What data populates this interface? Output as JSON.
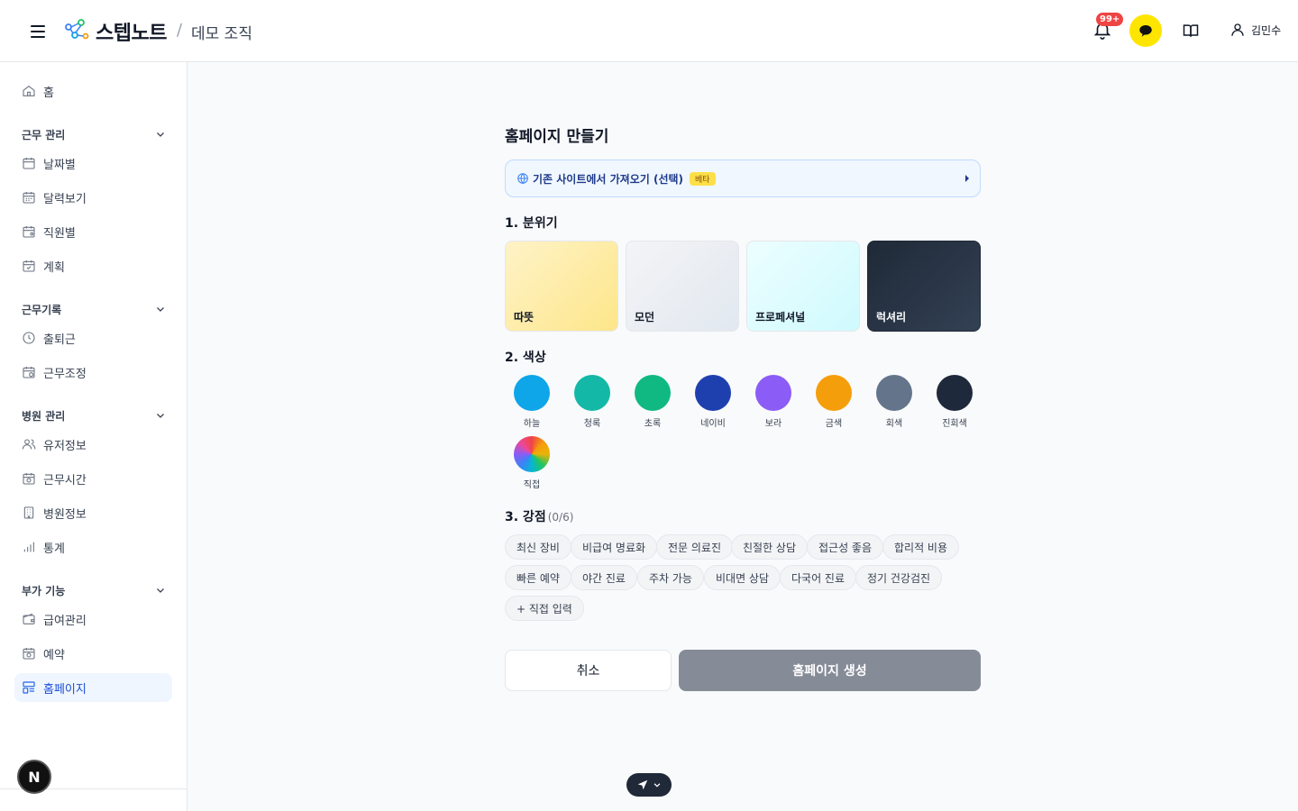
{
  "header": {
    "brand": "스텝노트",
    "separator": "/",
    "org": "데모 조직",
    "notif_badge": "99+",
    "user_name": "김민수"
  },
  "sidebar": {
    "home": "홈",
    "sections": [
      {
        "label": "근무 관리",
        "items": [
          "날짜별",
          "달력보기",
          "직원별",
          "계획"
        ]
      },
      {
        "label": "근무기록",
        "items": [
          "출퇴근",
          "근무조정"
        ]
      },
      {
        "label": "병원 관리",
        "items": [
          "유저정보",
          "근무시간",
          "병원정보",
          "통계"
        ]
      },
      {
        "label": "부가 기능",
        "items": [
          "급여관리",
          "예약",
          "홈페이지"
        ]
      }
    ],
    "bottom_badge": "N"
  },
  "main": {
    "title": "홈페이지 만들기",
    "import_label": "기존 사이트에서 가져오기 (선택)",
    "beta_label": "베타",
    "step1": "1. 분위기",
    "moods": [
      {
        "label": "따뜻",
        "color": "#fde68a"
      },
      {
        "label": "모던",
        "color": "#e5e7eb"
      },
      {
        "label": "프로페셔널",
        "color": "#cffafe"
      },
      {
        "label": "럭셔리",
        "color": "#1f2937"
      }
    ],
    "step2": "2. 색상",
    "colors": [
      {
        "label": "하늘",
        "color": "#0ea5e9"
      },
      {
        "label": "청록",
        "color": "#14b8a6"
      },
      {
        "label": "초록",
        "color": "#10b981"
      },
      {
        "label": "네이비",
        "color": "#1e40af"
      },
      {
        "label": "보라",
        "color": "#8b5cf6"
      },
      {
        "label": "금색",
        "color": "#f59e0b"
      },
      {
        "label": "회색",
        "color": "#64748b"
      },
      {
        "label": "진회색",
        "color": "#1e293b"
      },
      {
        "label": "직접",
        "color": "rainbow"
      }
    ],
    "step3": "3. 강점",
    "step3_count": "(0/6)",
    "strengths": [
      "최신 장비",
      "비급여 명료화",
      "전문 의료진",
      "친절한 상담",
      "접근성 좋음",
      "합리적 비용",
      "빠른 예약",
      "야간 진료",
      "주차 가능",
      "비대면 상담",
      "다국어 진료",
      "정기 건강검진",
      "+ 직접 입력"
    ],
    "cancel": "취소",
    "create": "홈페이지 생성"
  }
}
